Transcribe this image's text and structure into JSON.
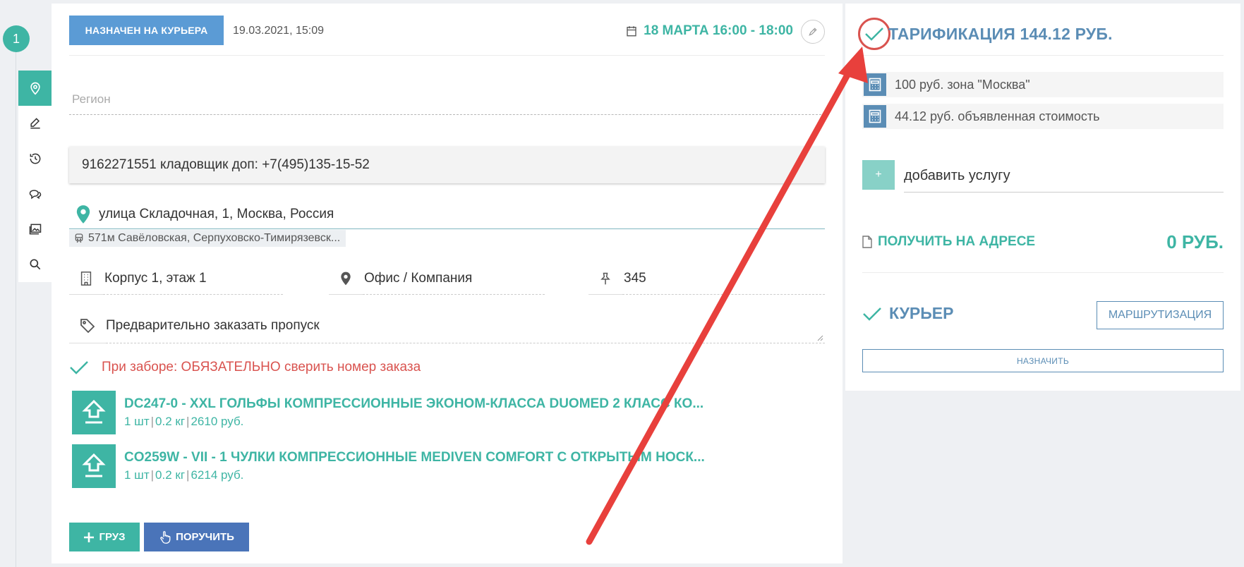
{
  "step": {
    "number": "1"
  },
  "order": {
    "status": "НАЗНАЧЕН НА КУРЬЕРА",
    "status_date": "19.03.2021, 15:09",
    "delivery_window": "18 МАРТА 16:00 - 18:00"
  },
  "form": {
    "region_placeholder": "Регион",
    "phone": "9162271551 кладовщик доп: +7(495)135-15-52",
    "address": "улица Складочная, 1, Москва, Россия",
    "metro": "571м Савёловская, Серпуховско-Тимирязевск...",
    "building": "Корпус 1, этаж 1",
    "office": "Офис / Компания",
    "apartment": "345",
    "note": "Предварительно заказать пропуск",
    "warning": "При заборе: ОБЯЗАТЕЛЬНО сверить номер заказа"
  },
  "items": [
    {
      "title": "DC247-0 - XXL ГОЛЬФЫ КОМПРЕССИОННЫЕ ЭКОНОМ-КЛАССА DUOMED 2 КЛАСС КО...",
      "qty": "1 шт",
      "weight": "0.2 кг",
      "price": "2610 руб."
    },
    {
      "title": "CO259W - VII - 1 ЧУЛКИ КОМПРЕССИОННЫЕ MEDIVEN COMFORT С ОТКРЫТЫМ НОСК...",
      "qty": "1 шт",
      "weight": "0.2 кг",
      "price": "6214 руб."
    }
  ],
  "actions": {
    "add_cargo": "ГРУЗ",
    "assign": "ПОРУЧИТЬ"
  },
  "tariff": {
    "title": "ТАРИФИКАЦИЯ 144.12 РУБ.",
    "lines": [
      {
        "text": "100 руб. зона \"Москва\""
      },
      {
        "text": "44.12 руб. объявленная стоимость"
      }
    ],
    "add_service_button": "+",
    "add_service": "добавить услугу",
    "receive_label": "ПОЛУЧИТЬ НА АДРЕСЕ",
    "receive_sum": "0 РУБ."
  },
  "courier": {
    "label": "КУРЬЕР",
    "routing": "МАРШРУТИЗАЦИЯ",
    "assign": "НАЗНАЧИТЬ"
  },
  "colors": {
    "teal": "#3eb5a4",
    "blue": "#5b9bd5",
    "steel_blue": "#5b8db5",
    "dark_blue": "#4a74b9",
    "warning_red": "#d9534f",
    "annotation_red": "#e8403c"
  },
  "icons": {
    "sidebar": [
      "map-pin-icon",
      "edit-icon",
      "history-icon",
      "chat-icon",
      "gallery-icon",
      "search-icon"
    ],
    "fields": [
      "building-icon",
      "map-marker-icon",
      "pin-icon",
      "tag-icon"
    ],
    "items": "upload-icon",
    "tariff_lines": "calculator-icon"
  }
}
